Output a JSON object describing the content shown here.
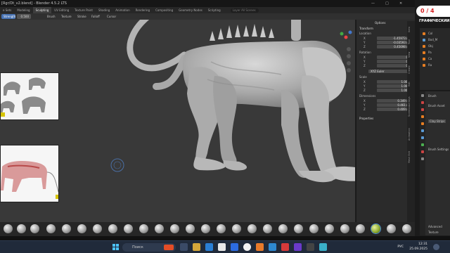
{
  "window": {
    "title": "[Rgr/Dt_v2.blend] - Blender 4.5.2 LTS",
    "minimize": "—",
    "maximize": "□",
    "close": "✕"
  },
  "workspaces": {
    "tabs": [
      "Modeling",
      "Sculpting",
      "UV Editing",
      "Texture Paint",
      "Shading",
      "Animation",
      "Rendering",
      "Compositing",
      "Geometry Nodes",
      "Scripting"
    ],
    "active": "Sculpting",
    "search_placeholder": "Layer All Scenes",
    "file_menu": "e Sets"
  },
  "toolheader": {
    "strength_label": "Strength",
    "strength_value": "0.500",
    "brush": "Brush",
    "texture": "Texture",
    "stroke": "Stroke",
    "falloff": "Falloff",
    "cursor": "Cursor"
  },
  "npanel": {
    "transform_header": "Transform",
    "location_header": "Location",
    "location": [
      {
        "axis": "X",
        "value": "-1.45973 m"
      },
      {
        "axis": "Y",
        "value": "-0.03593 m"
      },
      {
        "axis": "Z",
        "value": "0.45698 m"
      }
    ],
    "rotation_header": "Rotation",
    "rotation": [
      {
        "axis": "X",
        "value": "0°"
      },
      {
        "axis": "Y",
        "value": "0°"
      },
      {
        "axis": "Z",
        "value": "0°"
      }
    ],
    "rotation_mode": "XYZ Euler",
    "scale_header": "Scale",
    "scale": [
      {
        "axis": "X",
        "value": "1.000"
      },
      {
        "axis": "Y",
        "value": "1.000"
      },
      {
        "axis": "Z",
        "value": "1.000"
      }
    ],
    "dimensions_header": "Dimensions",
    "dimensions": [
      {
        "axis": "X",
        "value": "0.349 m"
      },
      {
        "axis": "Y",
        "value": "0.461 m"
      },
      {
        "axis": "Z",
        "value": "0.409 m"
      }
    ],
    "properties_header": "Properties",
    "header_options": "Options",
    "side_tabs": [
      "Item",
      "Tool",
      "View",
      "Create",
      "Edit",
      "Screencast Keys",
      "Animation",
      "Mesh Edit"
    ]
  },
  "overlay": {
    "counter": "0 / 4",
    "banner": "ГРАФИЧЕСКИЙ"
  },
  "outliner": {
    "items": [
      "Col",
      "Bod_M",
      "Obj",
      "Pa",
      "Ca",
      "Ra"
    ]
  },
  "properties": {
    "brush_label": "Brush",
    "brush_asset": "Brush Asset",
    "brush_name": "Clay Strips",
    "brush_settings": "Brush Settings",
    "advanced": "Advanced",
    "texture": "Texture"
  },
  "taskbar": {
    "search_placeholder": "Поиск",
    "lang": "РУС",
    "time": "12:31",
    "date": "25.09.2025"
  },
  "colors": {
    "accent": "#4772b3",
    "counter_text": "#d62020",
    "viewport_bg": "#393939",
    "model": "#b6b6b6"
  }
}
